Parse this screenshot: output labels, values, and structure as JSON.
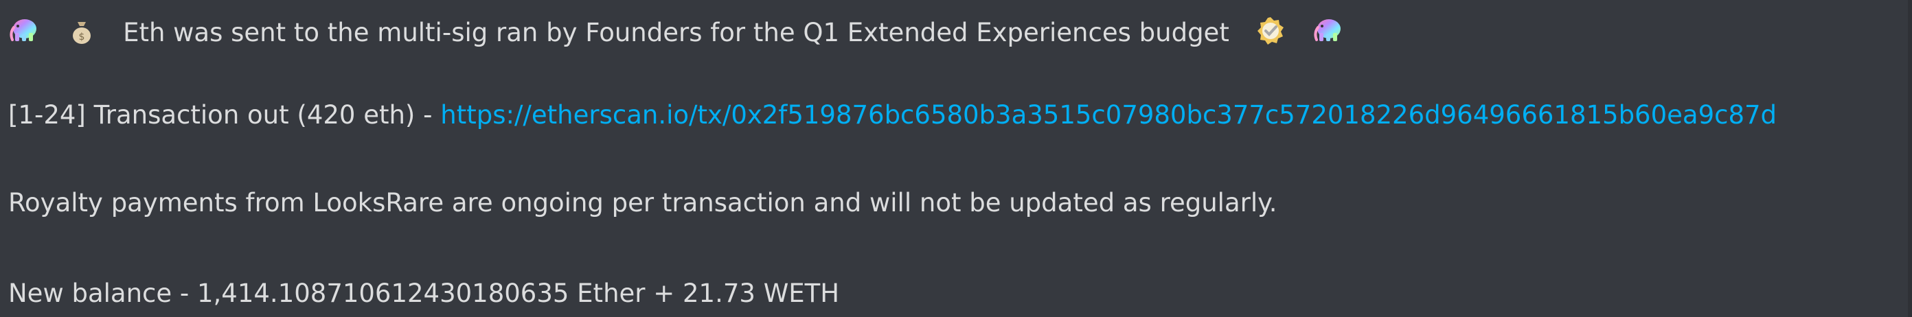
{
  "message": {
    "line1_text": "Eth was sent to the multi-sig ran by Founders for the Q1 Extended Experiences budget",
    "line2_prefix": "[1-24] Transaction out (420 eth) - ",
    "line2_link": "https://etherscan.io/tx/0x2f519876bc6580b3a3515c07980bc377c572018226d96496661815b60ea9c87d",
    "line3_text": "Royalty payments from LooksRare are ongoing per transaction and will not be updated as regularly.",
    "line4_text": "New balance - 1,414.108710612430180635 Ether + 21.73 WETH"
  },
  "icons": {
    "rainbow_elephant": "rainbow-elephant-icon",
    "money_bag": "money-bag-icon",
    "verified_badge": "verified-badge-icon"
  },
  "colors": {
    "background": "#36393f",
    "text": "#dcddde",
    "link": "#00aff4"
  }
}
